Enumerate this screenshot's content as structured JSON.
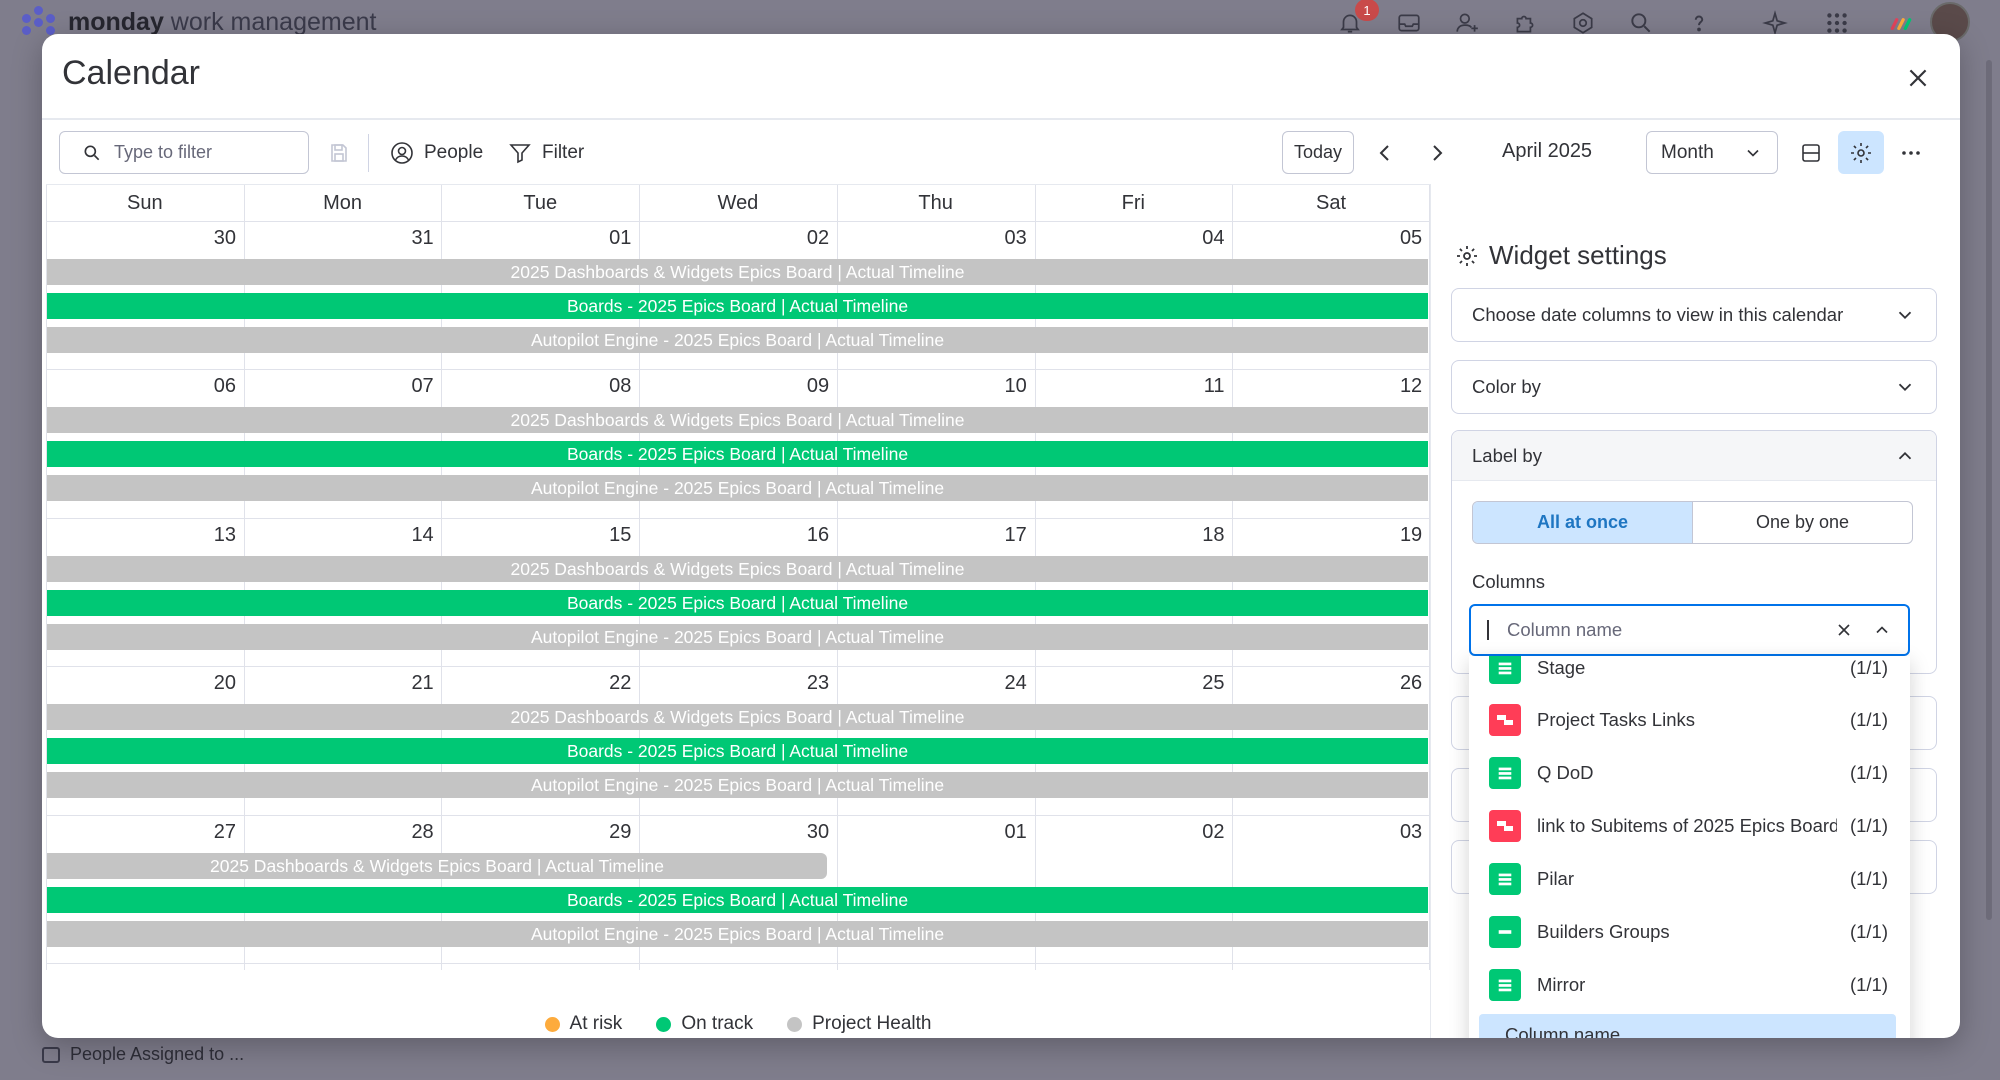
{
  "app": {
    "brand_bold": "monday",
    "brand_rest": " work management",
    "notification_count": "1"
  },
  "background": {
    "footer_item": "People Assigned to ..."
  },
  "modal": {
    "title": "Calendar"
  },
  "toolbar": {
    "search_placeholder": "Type to filter",
    "people_label": "People",
    "filter_label": "Filter",
    "today_label": "Today",
    "current_month": "April 2025",
    "view_mode": "Month"
  },
  "calendar": {
    "weekdays": [
      "Sun",
      "Mon",
      "Tue",
      "Wed",
      "Thu",
      "Fri",
      "Sat"
    ],
    "weeks": [
      [
        "30",
        "31",
        "01",
        "02",
        "03",
        "04",
        "05"
      ],
      [
        "06",
        "07",
        "08",
        "09",
        "10",
        "11",
        "12"
      ],
      [
        "13",
        "14",
        "15",
        "16",
        "17",
        "18",
        "19"
      ],
      [
        "20",
        "21",
        "22",
        "23",
        "24",
        "25",
        "26"
      ],
      [
        "27",
        "28",
        "29",
        "30",
        "01",
        "02",
        "03"
      ]
    ],
    "events": {
      "dashboards": "2025 Dashboards & Widgets Epics Board | Actual Timeline",
      "boards": "Boards - 2025 Epics Board | Actual Timeline",
      "autopilot": "Autopilot Engine - 2025 Epics Board | Actual Timeline"
    },
    "event_colors": {
      "grey": "#c4c4c4",
      "green": "#00c875"
    }
  },
  "legend": [
    {
      "label": "At risk",
      "color": "#fdab3d"
    },
    {
      "label": "On track",
      "color": "#00c875"
    },
    {
      "label": "Project Health",
      "color": "#c4c4c4"
    }
  ],
  "settings": {
    "title": "Widget settings",
    "date_columns": "Choose date columns to view in this calendar",
    "color_by": "Color by",
    "label_by": "Label by",
    "toggle_all": "All at once",
    "toggle_one": "One by one",
    "columns_label": "Columns",
    "column_placeholder": "Column name",
    "options": [
      {
        "name": "Stage",
        "count": "(1/1)",
        "icon": "status-column-icon",
        "color": "#00c875"
      },
      {
        "name": "Project Tasks Links",
        "count": "(1/1)",
        "icon": "connect-boards-icon",
        "color": "#ff3d57"
      },
      {
        "name": "Q DoD",
        "count": "(1/1)",
        "icon": "status-column-icon",
        "color": "#00c875"
      },
      {
        "name": "link to Subitems of 2025 Epics Board",
        "count": "(1/1)",
        "icon": "connect-boards-icon",
        "color": "#ff3d57"
      },
      {
        "name": "Pilar",
        "count": "(1/1)",
        "icon": "status-column-icon",
        "color": "#00c875"
      },
      {
        "name": "Builders Groups",
        "count": "(1/1)",
        "icon": "text-column-icon",
        "color": "#00c875"
      },
      {
        "name": "Mirror",
        "count": "(1/1)",
        "icon": "status-column-icon",
        "color": "#00c875"
      }
    ],
    "selected_option": "Column name"
  }
}
